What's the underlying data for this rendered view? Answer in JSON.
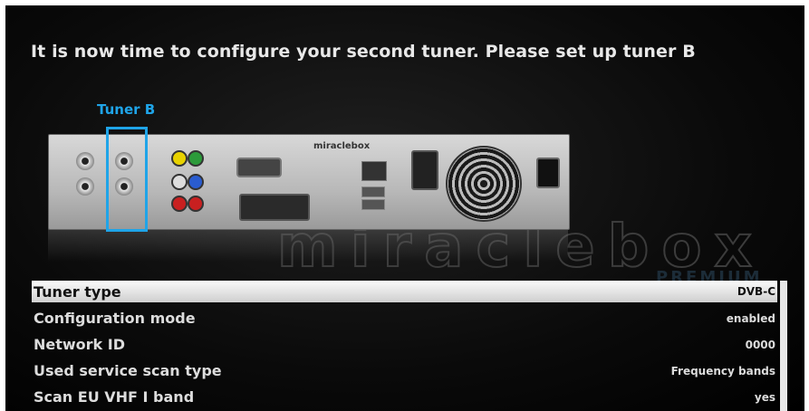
{
  "headline": "It is now time to configure your second tuner. Please set up tuner B",
  "tuner_label": "Tuner B",
  "watermark": "miraclebox",
  "watermark_sub": "PREMIUM",
  "device_brand": "miraclebox",
  "menu": {
    "items": [
      {
        "label": "Tuner type",
        "value": "DVB-C",
        "selected": true
      },
      {
        "label": "Configuration mode",
        "value": "enabled",
        "selected": false
      },
      {
        "label": "Network ID",
        "value": "0000",
        "selected": false
      },
      {
        "label": "Used service scan type",
        "value": "Frequency bands",
        "selected": false
      },
      {
        "label": "Scan EU VHF I band",
        "value": "yes",
        "selected": false
      }
    ]
  },
  "colors": {
    "accent": "#1fa4e8",
    "background": "#000000",
    "text": "#dcdcdc"
  }
}
